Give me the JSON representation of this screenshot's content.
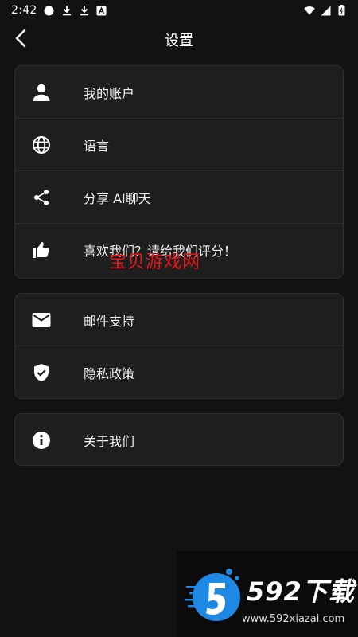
{
  "status_bar": {
    "time": "2:42",
    "icons": [
      "circle-icon",
      "download-icon",
      "download-icon",
      "a-box-icon",
      "wifi-icon",
      "signal-icon",
      "battery-icon"
    ]
  },
  "header": {
    "title": "设置"
  },
  "groups": [
    {
      "items": [
        {
          "label": "我的账户",
          "icon": "person-icon"
        },
        {
          "label": "语言",
          "icon": "globe-icon"
        },
        {
          "label": "分享 AI聊天",
          "icon": "share-icon"
        },
        {
          "label": "喜欢我们？请给我们评分！",
          "icon": "thumbs-up-icon"
        }
      ]
    },
    {
      "items": [
        {
          "label": "邮件支持",
          "icon": "mail-icon"
        },
        {
          "label": "隐私政策",
          "icon": "shield-check-icon"
        }
      ]
    },
    {
      "items": [
        {
          "label": "关于我们",
          "icon": "info-icon"
        }
      ]
    }
  ],
  "watermark": {
    "text": "宝贝游戏网",
    "logo_name": "592下载",
    "logo_url": "www.592xiazai.com"
  },
  "colors": {
    "background": "#121212",
    "card": "#1e1e1e",
    "divider": "#2c2c2c",
    "watermark_red": "#e8141c",
    "logo_blue": "#1e88e5"
  }
}
